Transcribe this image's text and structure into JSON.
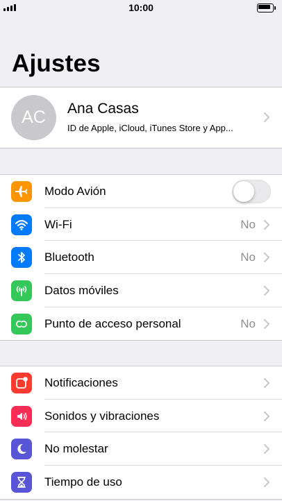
{
  "status_bar": {
    "time": "10:00"
  },
  "page_title": "Ajustes",
  "profile": {
    "initials": "AC",
    "name": "Ana Casas",
    "subtitle": "ID de Apple, iCloud, iTunes Store y App..."
  },
  "connectivity": {
    "airplane": {
      "label": "Modo Avión",
      "toggle_on": false,
      "icon": "airplane-icon",
      "color": "#ff9500"
    },
    "wifi": {
      "label": "Wi-Fi",
      "value": "No",
      "icon": "wifi-icon",
      "color": "#007aff"
    },
    "bluetooth": {
      "label": "Bluetooth",
      "value": "No",
      "icon": "bluetooth-icon",
      "color": "#007aff"
    },
    "cellular": {
      "label": "Datos móviles",
      "icon": "antenna-icon",
      "color": "#34c759"
    },
    "hotspot": {
      "label": "Punto de acceso personal",
      "value": "No",
      "icon": "hotspot-icon",
      "color": "#34c759"
    }
  },
  "notifications_group": {
    "notifications": {
      "label": "Notificaciones",
      "icon": "notifications-icon",
      "color": "#ff3b30"
    },
    "sounds": {
      "label": "Sonidos y vibraciones",
      "icon": "speaker-icon",
      "color": "#ff2d55"
    },
    "dnd": {
      "label": "No molestar",
      "icon": "moon-icon",
      "color": "#5856d6"
    },
    "screen_time": {
      "label": "Tiempo de uso",
      "icon": "hourglass-icon",
      "color": "#5856d6"
    }
  }
}
